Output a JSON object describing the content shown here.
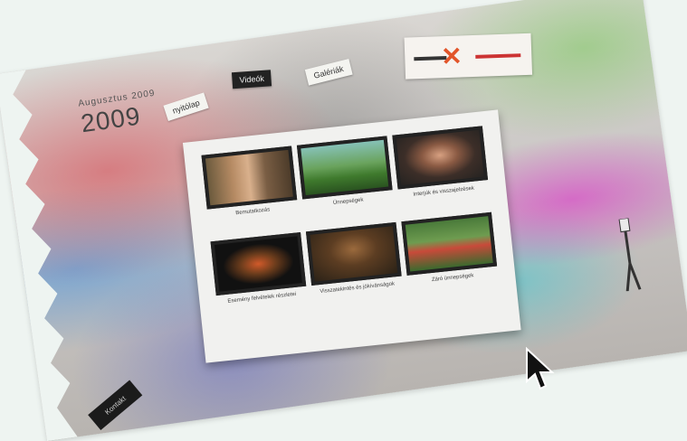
{
  "header": {
    "date_label": "Augusztus 2009",
    "year": "2009"
  },
  "tags": {
    "tag1": "nyitólap",
    "tag2": "Videók",
    "tag3": "Galériák",
    "bottom_tag": "Kontakt"
  },
  "gallery": {
    "items": [
      {
        "caption": "Bemutatkozás"
      },
      {
        "caption": "Ünnepségek"
      },
      {
        "caption": "Interjúk és visszajelzések"
      },
      {
        "caption": "Esemény felvételek részletei"
      },
      {
        "caption": "Visszatekintés és jókívánságok"
      },
      {
        "caption": "Záró ünnepségek"
      }
    ]
  },
  "colors": {
    "accent": "#e2552a",
    "paper": "#f1f1ef"
  },
  "icons": {
    "cursor": "arrow-cursor-icon",
    "logo": "x-logo-icon"
  }
}
